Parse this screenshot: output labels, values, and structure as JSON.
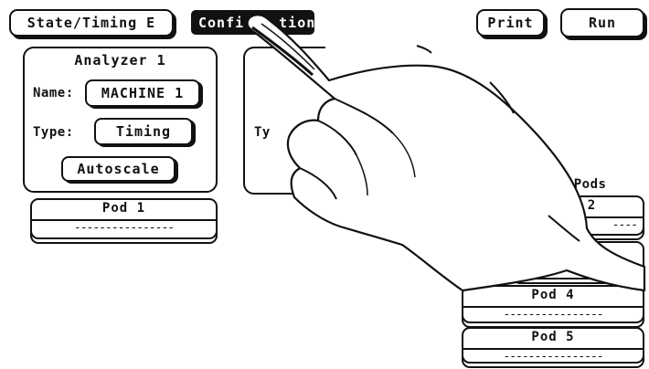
{
  "toolbar": {
    "state_timing_label": "State/Timing E",
    "config_label": "Confi",
    "config_label_tail": "tion",
    "print_label": "Print",
    "run_label": "Run"
  },
  "analyzer1": {
    "title": "Analyzer 1",
    "name_label": "Name:",
    "name_value": "MACHINE 1",
    "type_label": "Type:",
    "type_value": "Timing",
    "autoscale_label": "Autoscale"
  },
  "analyzer2": {
    "type_label_partial": "Ty"
  },
  "pods_left": [
    {
      "label": "Pod 1",
      "dashes": "----------------"
    }
  ],
  "pods_right": {
    "header_partial": "ned Pods",
    "items": [
      {
        "label": "2",
        "dashes": "----"
      },
      {
        "label": "",
        "dashes": "------------"
      },
      {
        "label": "Pod 4",
        "dashes": "----------------"
      },
      {
        "label": "Pod 5",
        "dashes": "----------------"
      }
    ]
  }
}
